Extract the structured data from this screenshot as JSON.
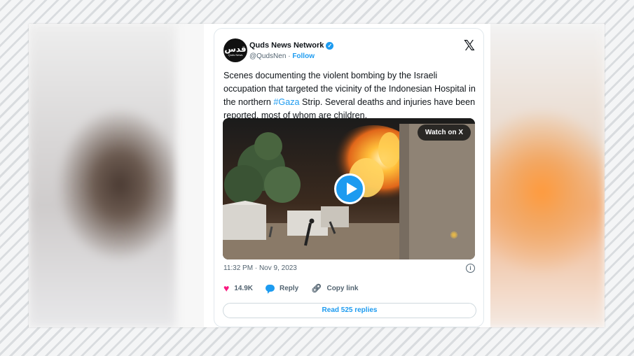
{
  "tweet": {
    "author_name": "Quds News Network",
    "avatar_text": "قدس",
    "avatar_subtext": "Quds News",
    "handle": "@QudsNen",
    "separator": "·",
    "follow_label": "Follow",
    "text_before": "Scenes documenting the violent bombing by the Israeli occupation that targeted the vicinity of the Indonesian Hospital in the northern ",
    "hashtag": "#Gaza",
    "text_after": " Strip. Several deaths and injuries have been reported, most of whom are children.",
    "watch_label": "Watch on X",
    "timestamp": "11:32 PM · Nov 9, 2023",
    "likes": "14.9K",
    "reply_label": "Reply",
    "copy_link_label": "Copy link",
    "read_replies_label": "Read 525 replies"
  },
  "colors": {
    "accent": "#1d9bf0",
    "like": "#f91880",
    "text": "#0f1419",
    "muted": "#536471"
  },
  "icons": [
    "verified-badge-icon",
    "x-logo-icon",
    "play-icon",
    "info-icon",
    "heart-icon",
    "reply-bubble-icon",
    "link-icon"
  ]
}
